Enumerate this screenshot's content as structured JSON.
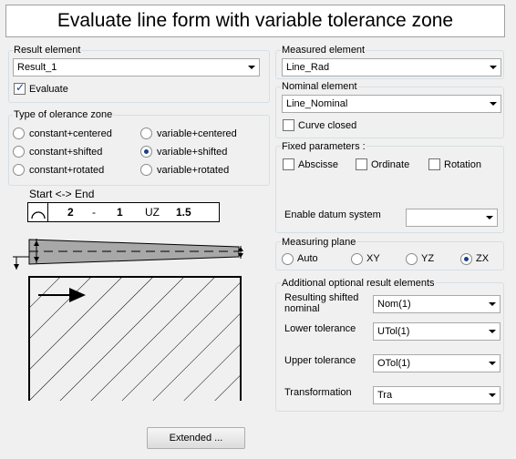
{
  "title": "Evaluate line form with variable tolerance zone",
  "result_element": {
    "label": "Result element",
    "value": "Result_1",
    "evaluate_label": "Evaluate",
    "evaluate_checked": true
  },
  "tolerance_type": {
    "label": "Type of olerance zone",
    "options": [
      "constant+centered",
      "constant+shifted",
      "constant+rotated",
      "variable+centered",
      "variable+shifted",
      "variable+rotated"
    ],
    "selected": "variable+shifted"
  },
  "diagram": {
    "start_end_label": "Start <-> End",
    "code": {
      "a": "2",
      "dash": "-",
      "b": "1",
      "uz": "UZ",
      "val": "1.5"
    }
  },
  "measured_element": {
    "label": "Measured element",
    "value": "Line_Rad"
  },
  "nominal_element": {
    "label": "Nominal element",
    "value": "Line_Nominal",
    "curve_closed_label": "Curve closed",
    "curve_closed_checked": false
  },
  "fixed_parameters": {
    "label": "Fixed parameters :",
    "abscisse": "Abscisse",
    "ordinate": "Ordinate",
    "rotation": "Rotation",
    "enable_datum_label": "Enable datum system",
    "datum_value": ""
  },
  "measuring_plane": {
    "label": "Measuring plane",
    "options": [
      "Auto",
      "XY",
      "YZ",
      "ZX"
    ],
    "selected": "ZX"
  },
  "additional": {
    "label": "Additional optional result elements",
    "shifted_label": "Resulting shifted nominal",
    "shifted_value": "Nom(1)",
    "lower_label": "Lower tolerance",
    "lower_value": "UTol(1)",
    "upper_label": "Upper tolerance",
    "upper_value": "OTol(1)",
    "transform_label": "Transformation",
    "transform_value": "Tra"
  },
  "extended_button": "Extended ...",
  "colors": {
    "accent": "#1a3f8a",
    "wedge": "#a8a8a8",
    "frame": "#d5dfe5"
  },
  "icons": {
    "profile": "arc-profile-icon",
    "dropdown": "chevron-down-icon"
  }
}
